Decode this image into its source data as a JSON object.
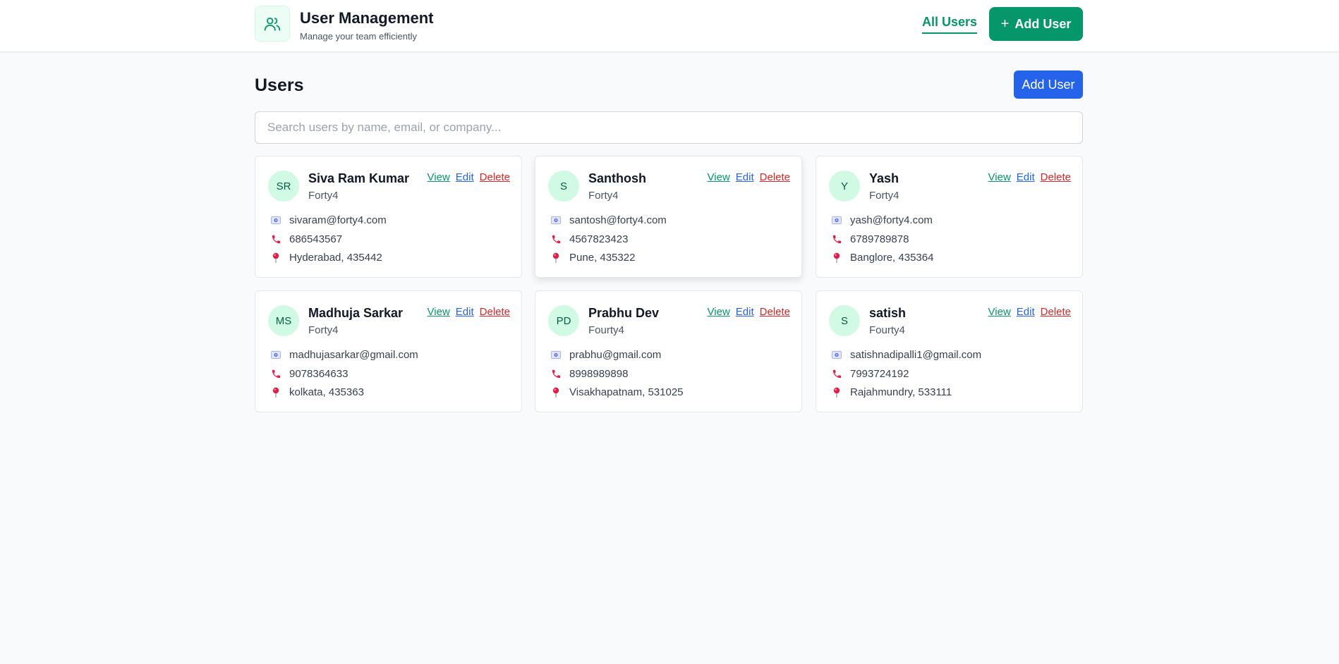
{
  "header": {
    "title": "User Management",
    "subtitle": "Manage your team efficiently",
    "nav_all_users": "All Users",
    "add_user_label": "Add User",
    "accent": "#059669"
  },
  "main": {
    "title": "Users",
    "add_user_label": "Add User",
    "search_placeholder": "Search users by name, email, or company...",
    "search_value": "",
    "action_labels": {
      "view": "View",
      "edit": "Edit",
      "delete": "Delete"
    },
    "users": [
      {
        "initials": "SR",
        "name": "Siva Ram Kumar",
        "company": "Forty4",
        "email": "sivaram@forty4.com",
        "phone": "686543567",
        "location": "Hyderabad, 435442"
      },
      {
        "initials": "S",
        "name": "Santhosh",
        "company": "Forty4",
        "email": "santosh@forty4.com",
        "phone": "4567823423",
        "location": "Pune, 435322"
      },
      {
        "initials": "Y",
        "name": "Yash",
        "company": "Forty4",
        "email": "yash@forty4.com",
        "phone": "6789789878",
        "location": "Banglore, 435364"
      },
      {
        "initials": "MS",
        "name": "Madhuja Sarkar",
        "company": "Forty4",
        "email": "madhujasarkar@gmail.com",
        "phone": "9078364633",
        "location": "kolkata, 435363"
      },
      {
        "initials": "PD",
        "name": "Prabhu Dev",
        "company": "Fourty4",
        "email": "prabhu@gmail.com",
        "phone": "8998989898",
        "location": "Visakhapatnam, 531025"
      },
      {
        "initials": "S",
        "name": "satish",
        "company": "Fourty4",
        "email": "satishnadipalli1@gmail.com",
        "phone": "7993724192",
        "location": "Rajahmundry, 533111"
      }
    ],
    "icons": {
      "email": "id-card-icon",
      "phone": "phone-icon",
      "location": "pin-icon"
    },
    "colors": {
      "add_button": "#2563eb",
      "view": "#059669",
      "edit": "#2563eb",
      "delete": "#dc2626",
      "avatar_bg": "#d1fae5"
    }
  }
}
